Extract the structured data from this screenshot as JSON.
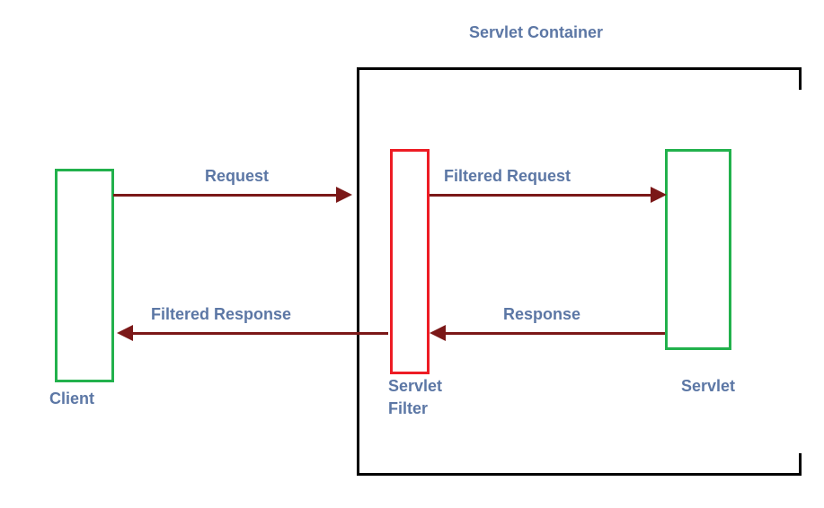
{
  "labels": {
    "container": "Servlet Container",
    "client": "Client",
    "filter": "Servlet",
    "filter2": "Filter",
    "servlet": "Servlet",
    "request": "Request",
    "filtered_request": "Filtered Request",
    "response": "Response",
    "filtered_response": "Filtered Response"
  }
}
